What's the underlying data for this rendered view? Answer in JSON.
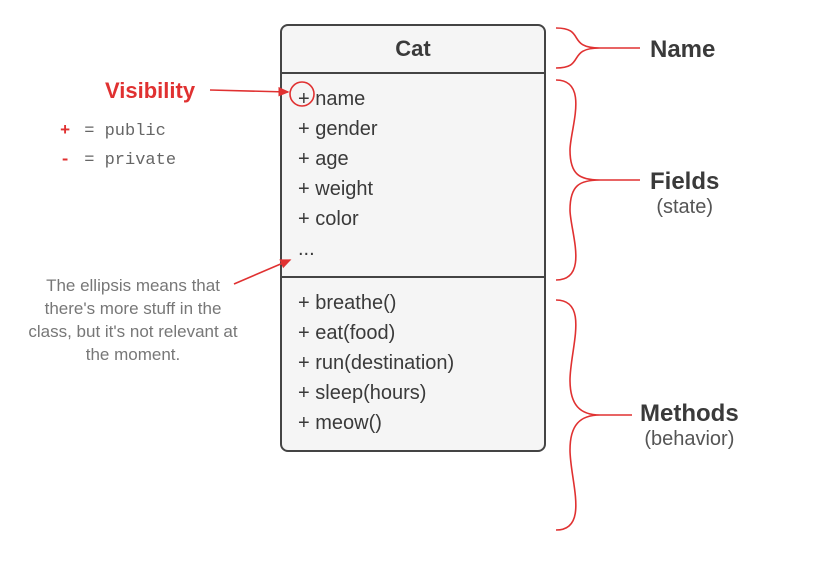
{
  "class": {
    "name": "Cat",
    "fields": [
      {
        "vis": "+",
        "name": "name"
      },
      {
        "vis": "+",
        "name": "gender"
      },
      {
        "vis": "+",
        "name": "age"
      },
      {
        "vis": "+",
        "name": "weight"
      },
      {
        "vis": "+",
        "name": "color"
      }
    ],
    "fields_ellipsis": "...",
    "methods": [
      {
        "vis": "+",
        "sig": "breathe()"
      },
      {
        "vis": "+",
        "sig": "eat(food)"
      },
      {
        "vis": "+",
        "sig": "run(destination)"
      },
      {
        "vis": "+",
        "sig": "sleep(hours)"
      },
      {
        "vis": "+",
        "sig": "meow()"
      }
    ]
  },
  "labels": {
    "name": "Name",
    "fields_title": "Fields",
    "fields_sub": "(state)",
    "methods_title": "Methods",
    "methods_sub": "(behavior)",
    "visibility": "Visibility"
  },
  "legend": {
    "public_symbol": "+",
    "public_word": "public",
    "private_symbol": "-",
    "private_word": "private",
    "equals": "="
  },
  "note": {
    "ellipsis": "The ellipsis means that there's more stuff in the class, but it's not relevant at the moment."
  },
  "colors": {
    "accent": "#e03131",
    "box_border": "#444",
    "box_bg": "#f5f5f5"
  }
}
